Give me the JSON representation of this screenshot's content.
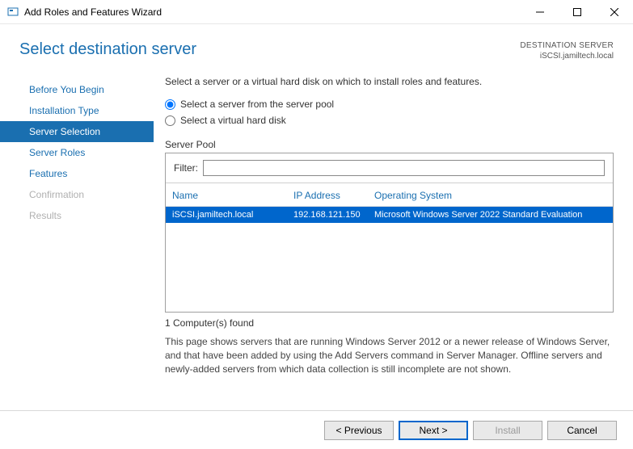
{
  "window": {
    "title": "Add Roles and Features Wizard"
  },
  "header": {
    "page_title": "Select destination server",
    "dest_label": "DESTINATION SERVER",
    "dest_name": "iSCSI.jamiltech.local"
  },
  "sidebar": {
    "steps": [
      {
        "label": "Before You Begin",
        "state": "normal"
      },
      {
        "label": "Installation Type",
        "state": "normal"
      },
      {
        "label": "Server Selection",
        "state": "active"
      },
      {
        "label": "Server Roles",
        "state": "normal"
      },
      {
        "label": "Features",
        "state": "normal"
      },
      {
        "label": "Confirmation",
        "state": "disabled"
      },
      {
        "label": "Results",
        "state": "disabled"
      }
    ]
  },
  "content": {
    "instruction": "Select a server or a virtual hard disk on which to install roles and features.",
    "radio1": "Select a server from the server pool",
    "radio2": "Select a virtual hard disk",
    "pool_label": "Server Pool",
    "filter_label": "Filter:",
    "filter_value": "",
    "columns": {
      "name": "Name",
      "ip": "IP Address",
      "os": "Operating System"
    },
    "rows": [
      {
        "name": "iSCSI.jamiltech.local",
        "ip": "192.168.121.150",
        "os": "Microsoft Windows Server 2022 Standard Evaluation"
      }
    ],
    "found": "1 Computer(s) found",
    "help": "This page shows servers that are running Windows Server 2012 or a newer release of Windows Server, and that have been added by using the Add Servers command in Server Manager. Offline servers and newly-added servers from which data collection is still incomplete are not shown."
  },
  "footer": {
    "previous": "< Previous",
    "next": "Next >",
    "install": "Install",
    "cancel": "Cancel"
  }
}
